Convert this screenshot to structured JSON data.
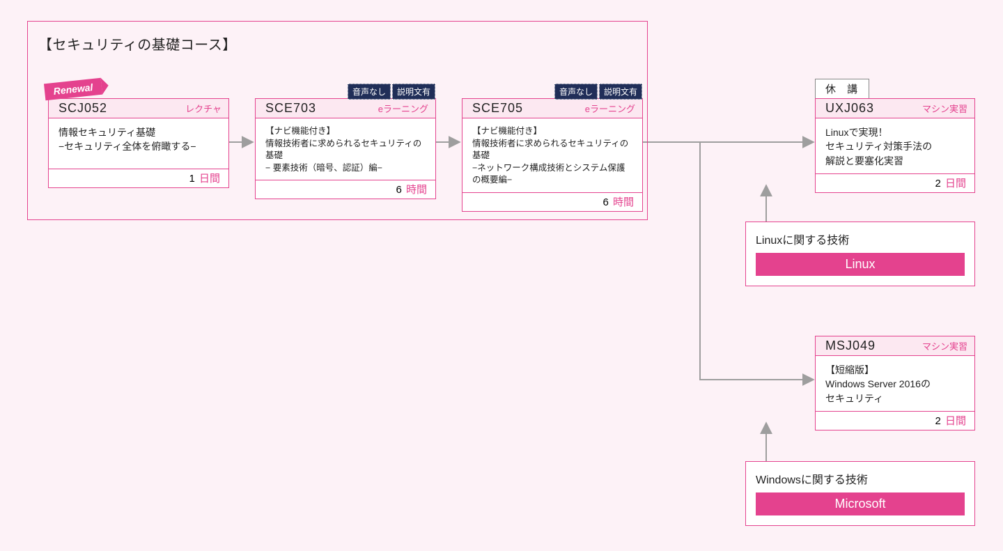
{
  "group": {
    "title": "【セキュリティの基礎コース】"
  },
  "cards": {
    "c1": {
      "code": "SCJ052",
      "type": "レクチャ",
      "title_l1": "情報セキュリティ基礎",
      "title_l2": "−セキュリティ全体を俯瞰する−",
      "dur_num": "1",
      "dur_unit": "日間",
      "ribbon": "Renewal"
    },
    "c2": {
      "code": "SCE703",
      "type": "eラーニング",
      "title_l1": "【ナビ機能付き】",
      "title_l2": "情報技術者に求められるセキュリティの基礎",
      "title_l3": "− 要素技術（暗号、認証）編−",
      "dur_num": "6",
      "dur_unit": "時間",
      "chip1": "音声なし",
      "chip2": "説明文有"
    },
    "c3": {
      "code": "SCE705",
      "type": "eラーニング",
      "title_l1": "【ナビ機能付き】",
      "title_l2": "情報技術者に求められるセキュリティの基礎",
      "title_l3": "−ネットワーク構成技術とシステム保護の概要編−",
      "dur_num": "6",
      "dur_unit": "時間",
      "chip1": "音声なし",
      "chip2": "説明文有"
    },
    "c4": {
      "code": "UXJ063",
      "type": "マシン実習",
      "title_l1": "Linuxで実現！",
      "title_l2": "セキュリティ対策手法の",
      "title_l3": "解説と要塞化実習",
      "dur_num": "2",
      "dur_unit": "日間",
      "suspend": "休 講"
    },
    "c5": {
      "code": "MSJ049",
      "type": "マシン実習",
      "title_l1": "【短縮版】",
      "title_l2": "Windows Server 2016の",
      "title_l3": "セキュリティ",
      "dur_num": "2",
      "dur_unit": "日間"
    }
  },
  "prereq": {
    "linux": {
      "caption": "Linuxに関する技術",
      "bar": "Linux"
    },
    "windows": {
      "caption": "Windowsに関する技術",
      "bar": "Microsoft"
    }
  }
}
